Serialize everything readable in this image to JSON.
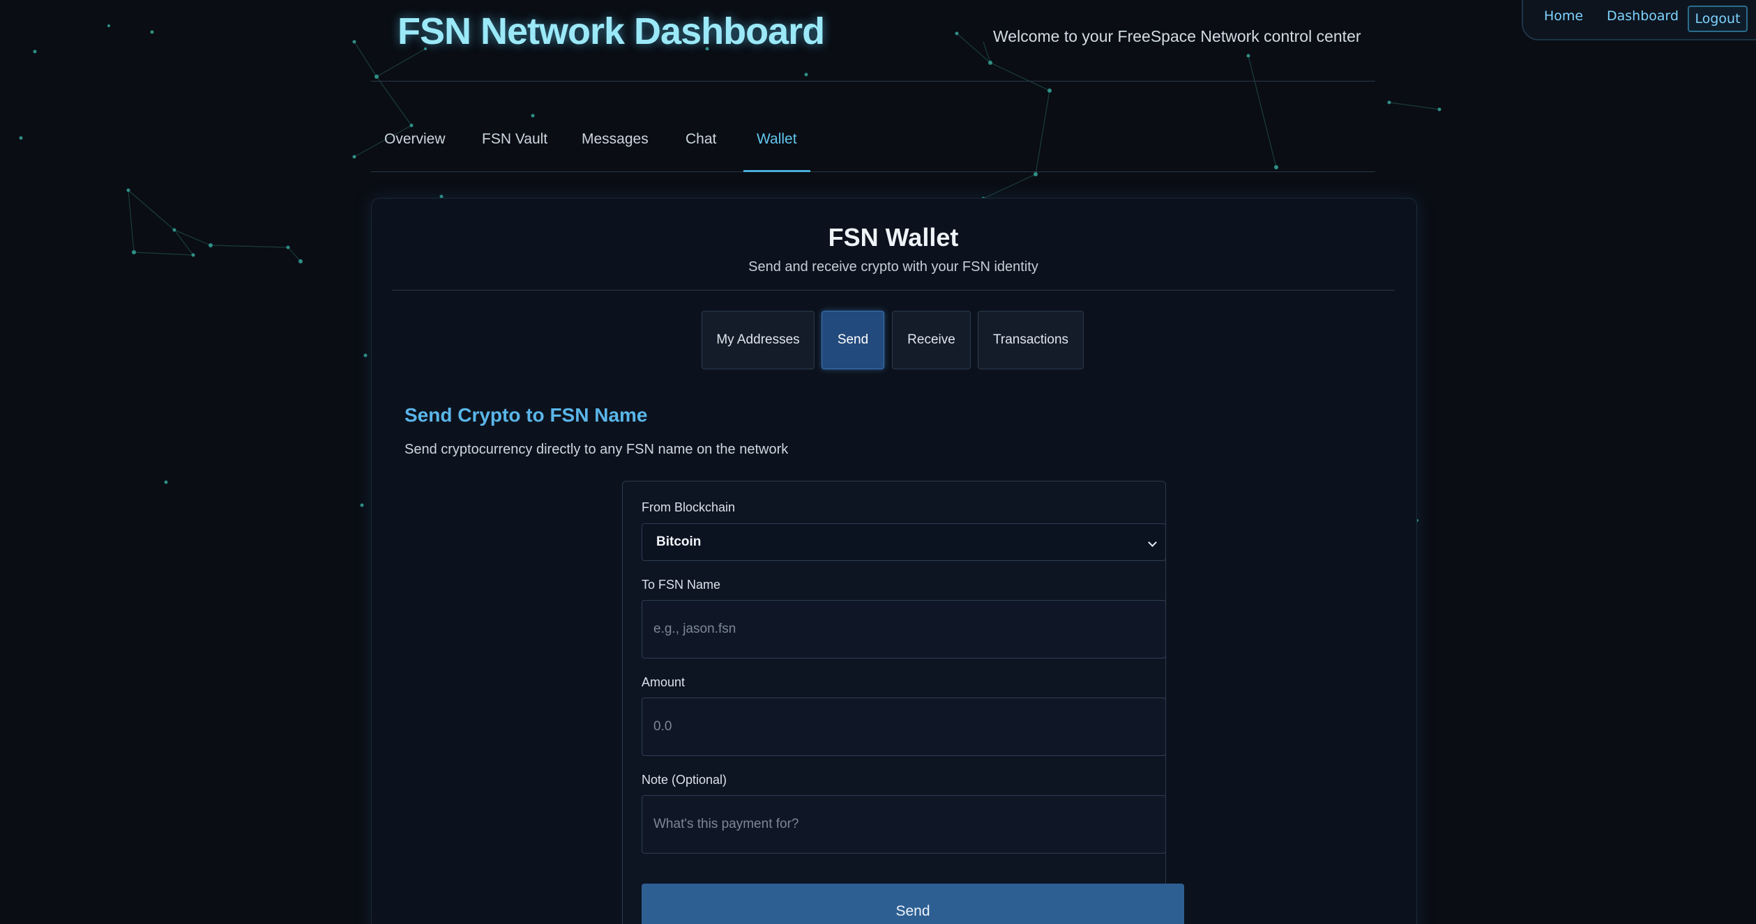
{
  "top_nav": {
    "home": "Home",
    "dashboard": "Dashboard",
    "logout": "Logout"
  },
  "header": {
    "title": "FSN Network Dashboard",
    "welcome": "Welcome to your FreeSpace Network control center"
  },
  "main_tabs": [
    {
      "label": "Overview",
      "active": false
    },
    {
      "label": "FSN Vault",
      "active": false
    },
    {
      "label": "Messages",
      "active": false
    },
    {
      "label": "Chat",
      "active": false
    },
    {
      "label": "Wallet",
      "active": true
    }
  ],
  "wallet": {
    "title": "FSN Wallet",
    "subtitle": "Send and receive crypto with your FSN identity",
    "sub_tabs": [
      {
        "label": "My Addresses",
        "active": false
      },
      {
        "label": "Send",
        "active": true
      },
      {
        "label": "Receive",
        "active": false
      },
      {
        "label": "Transactions",
        "active": false
      }
    ],
    "section_title": "Send Crypto to FSN Name",
    "section_subtitle": "Send cryptocurrency directly to any FSN name on the network",
    "form": {
      "blockchain_label": "From Blockchain",
      "blockchain_value": "Bitcoin",
      "to_label": "To FSN Name",
      "to_placeholder": "e.g., jason.fsn",
      "amount_label": "Amount",
      "amount_placeholder": "0.0",
      "note_label": "Note (Optional)",
      "note_placeholder": "What's this payment for?",
      "send_label": "Send"
    }
  },
  "colors": {
    "background": "#0a0d14",
    "accent": "#5ab6ea",
    "title_glow": "#9be9f8",
    "active_tab": "#234a7c",
    "send_button": "#2e5f93"
  }
}
